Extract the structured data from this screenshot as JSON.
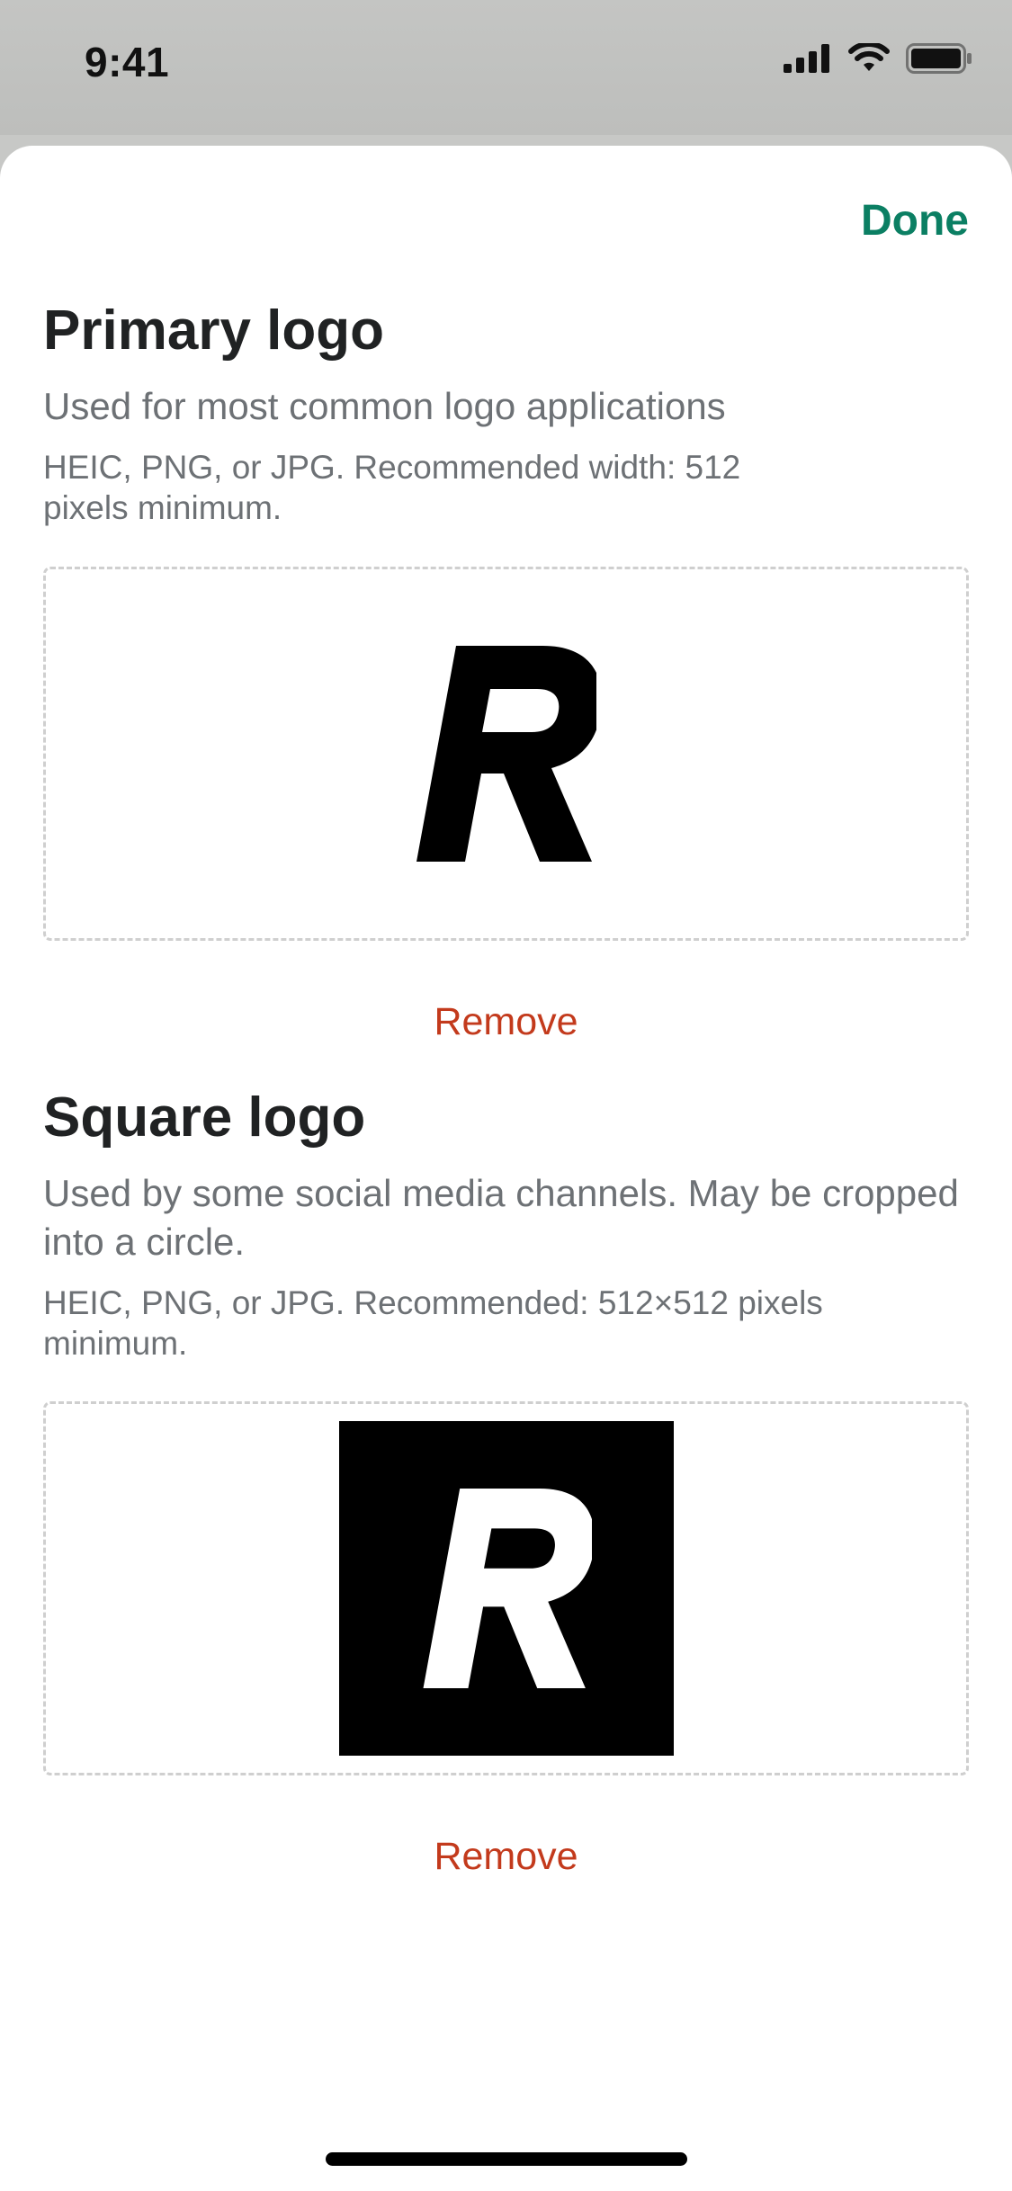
{
  "status_bar": {
    "time": "9:41"
  },
  "header": {
    "done_label": "Done",
    "accent_color": "#0b7f63"
  },
  "primary_logo": {
    "title": "Primary logo",
    "description": "Used for most common logo applications",
    "hint": "HEIC, PNG, or JPG. Recommended width: 512 pixels minimum.",
    "remove_label": "Remove"
  },
  "square_logo": {
    "title": "Square logo",
    "description": "Used by some social media channels. May be cropped into a circle.",
    "hint": "HEIC, PNG, or JPG. Recommended: 512×512 pixels minimum.",
    "remove_label": "Remove"
  },
  "colors": {
    "remove": "#c33a1c",
    "secondary_text": "#6d7175"
  }
}
